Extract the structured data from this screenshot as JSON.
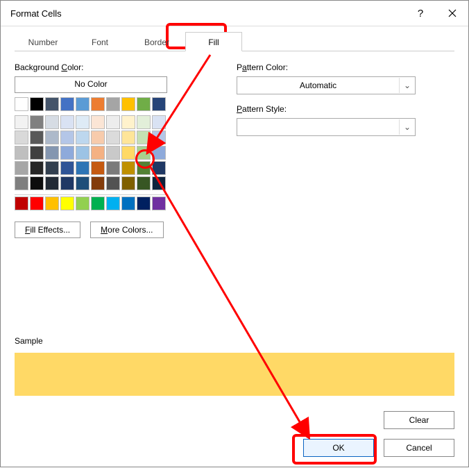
{
  "title": "Format Cells",
  "tabs": [
    "Number",
    "Font",
    "Border",
    "Fill"
  ],
  "active_tab": "Fill",
  "left": {
    "bg_label_html": "Background <u>C</u>olor:",
    "no_color": "No Color",
    "fill_effects": "Fill Effects...",
    "more_colors": "More Colors..."
  },
  "right": {
    "pattern_color_label_html": "P<u>a</u>ttern Color:",
    "pattern_color_value": "Automatic",
    "pattern_style_label_html": "<u>P</u>attern Style:",
    "pattern_style_value": ""
  },
  "sample_label": "Sample",
  "sample_color": "#ffd966",
  "buttons": {
    "clear": "Clear",
    "ok": "OK",
    "cancel": "Cancel"
  },
  "theme_row": [
    "#ffffff",
    "#000000",
    "#44546a",
    "#4472c4",
    "#5b9bd5",
    "#ed7d31",
    "#a5a5a5",
    "#ffc000",
    "#70ad47",
    "#264478"
  ],
  "theme_tints": [
    [
      "#f2f2f2",
      "#808080",
      "#d6dce4",
      "#d9e2f3",
      "#deebf6",
      "#fbe5d5",
      "#ededed",
      "#fff2cc",
      "#e2efd9",
      "#d9e2f3"
    ],
    [
      "#d9d9d9",
      "#595959",
      "#adb9ca",
      "#b4c6e7",
      "#bdd7ee",
      "#f7cbac",
      "#dbdbdb",
      "#fee599",
      "#c5e0b3",
      "#b4c6e7"
    ],
    [
      "#bfbfbf",
      "#404040",
      "#8496b0",
      "#8eaadb",
      "#9cc3e5",
      "#f4b183",
      "#c9c9c9",
      "#ffd966",
      "#a8d08d",
      "#8eaadb"
    ],
    [
      "#a6a6a6",
      "#262626",
      "#323f4f",
      "#2f5496",
      "#2e75b5",
      "#c55a11",
      "#7b7b7b",
      "#bf9000",
      "#538135",
      "#1f3864"
    ],
    [
      "#7f7f7f",
      "#0d0d0d",
      "#222a35",
      "#1f3864",
      "#1e4e79",
      "#833c0b",
      "#525252",
      "#7f6000",
      "#375623",
      "#0f243e"
    ]
  ],
  "standard_row": [
    "#c00000",
    "#ff0000",
    "#ffc000",
    "#ffff00",
    "#92d050",
    "#00b050",
    "#00b0f0",
    "#0070c0",
    "#002060",
    "#7030a0"
  ]
}
